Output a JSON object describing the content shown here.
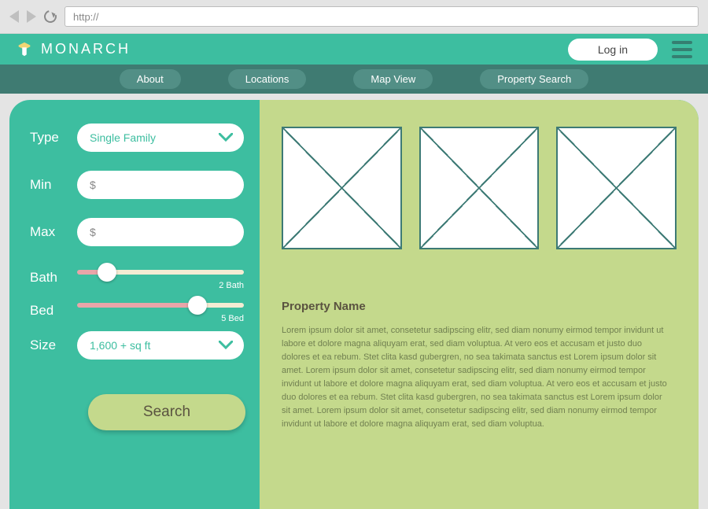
{
  "browser": {
    "url_prefix": "http://"
  },
  "header": {
    "brand": "MONARCH",
    "login": "Log in"
  },
  "nav": {
    "items": [
      "About",
      "Locations",
      "Map View",
      "Property Search"
    ]
  },
  "filters": {
    "type": {
      "label": "Type",
      "value": "Single Family"
    },
    "min": {
      "label": "Min",
      "placeholder": "$"
    },
    "max": {
      "label": "Max",
      "placeholder": "$"
    },
    "bath": {
      "label": "Bath",
      "value_text": "2 Bath",
      "percent": 18
    },
    "bed": {
      "label": "Bed",
      "value_text": "5 Bed",
      "percent": 72
    },
    "size": {
      "label": "Size",
      "value": "1,600 + sq ft"
    },
    "search": "Search"
  },
  "property": {
    "title": "Property Name",
    "body": "Lorem ipsum dolor sit amet, consetetur sadipscing elitr, sed diam nonumy eirmod tempor invidunt ut labore et dolore magna aliquyam erat, sed diam voluptua. At vero eos et accusam et justo duo dolores et ea rebum. Stet clita kasd gubergren, no sea takimata sanctus est Lorem ipsum dolor sit amet. Lorem ipsum dolor sit amet, consetetur sadipscing elitr, sed diam nonumy eirmod tempor invidunt ut labore et dolore magna aliquyam erat, sed diam voluptua. At vero eos et accusam et justo duo dolores et ea rebum. Stet clita kasd gubergren, no sea takimata sanctus est Lorem ipsum dolor sit amet. Lorem ipsum dolor sit amet, consetetur sadipscing elitr, sed diam nonumy eirmod tempor invidunt ut labore et dolore magna aliquyam erat, sed diam voluptua."
  },
  "colors": {
    "teal": "#3dbea0",
    "dark_teal": "#3f7b72",
    "olive": "#c4d98c"
  }
}
